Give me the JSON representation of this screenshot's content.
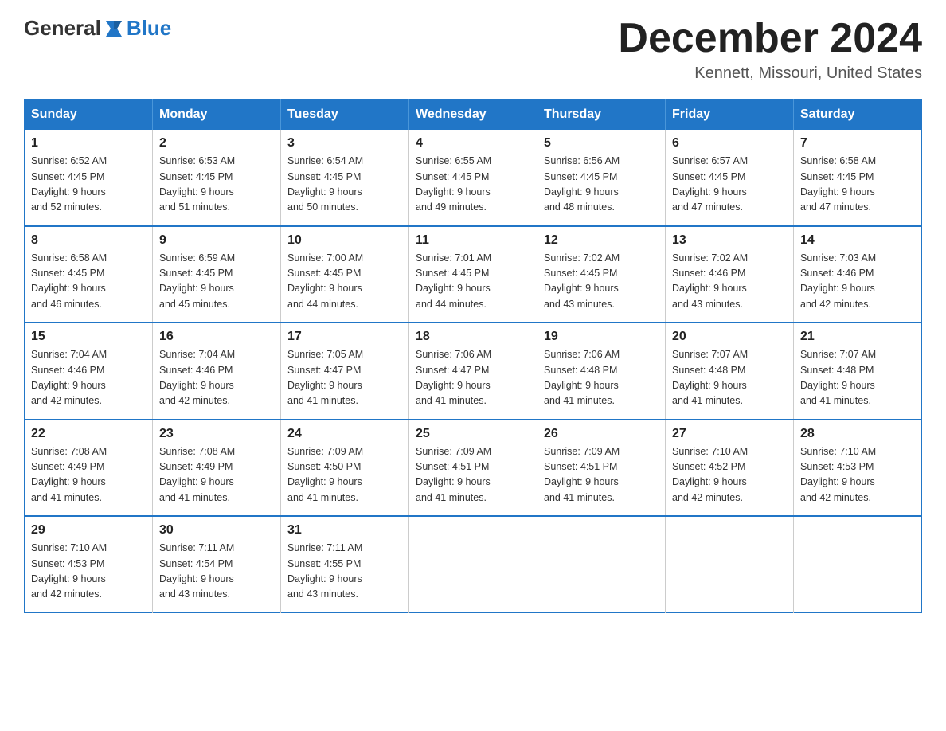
{
  "header": {
    "logo_general": "General",
    "logo_blue": "Blue",
    "month_title": "December 2024",
    "location": "Kennett, Missouri, United States"
  },
  "weekdays": [
    "Sunday",
    "Monday",
    "Tuesday",
    "Wednesday",
    "Thursday",
    "Friday",
    "Saturday"
  ],
  "weeks": [
    [
      {
        "day": "1",
        "sunrise": "6:52 AM",
        "sunset": "4:45 PM",
        "daylight": "9 hours and 52 minutes."
      },
      {
        "day": "2",
        "sunrise": "6:53 AM",
        "sunset": "4:45 PM",
        "daylight": "9 hours and 51 minutes."
      },
      {
        "day": "3",
        "sunrise": "6:54 AM",
        "sunset": "4:45 PM",
        "daylight": "9 hours and 50 minutes."
      },
      {
        "day": "4",
        "sunrise": "6:55 AM",
        "sunset": "4:45 PM",
        "daylight": "9 hours and 49 minutes."
      },
      {
        "day": "5",
        "sunrise": "6:56 AM",
        "sunset": "4:45 PM",
        "daylight": "9 hours and 48 minutes."
      },
      {
        "day": "6",
        "sunrise": "6:57 AM",
        "sunset": "4:45 PM",
        "daylight": "9 hours and 47 minutes."
      },
      {
        "day": "7",
        "sunrise": "6:58 AM",
        "sunset": "4:45 PM",
        "daylight": "9 hours and 47 minutes."
      }
    ],
    [
      {
        "day": "8",
        "sunrise": "6:58 AM",
        "sunset": "4:45 PM",
        "daylight": "9 hours and 46 minutes."
      },
      {
        "day": "9",
        "sunrise": "6:59 AM",
        "sunset": "4:45 PM",
        "daylight": "9 hours and 45 minutes."
      },
      {
        "day": "10",
        "sunrise": "7:00 AM",
        "sunset": "4:45 PM",
        "daylight": "9 hours and 44 minutes."
      },
      {
        "day": "11",
        "sunrise": "7:01 AM",
        "sunset": "4:45 PM",
        "daylight": "9 hours and 44 minutes."
      },
      {
        "day": "12",
        "sunrise": "7:02 AM",
        "sunset": "4:45 PM",
        "daylight": "9 hours and 43 minutes."
      },
      {
        "day": "13",
        "sunrise": "7:02 AM",
        "sunset": "4:46 PM",
        "daylight": "9 hours and 43 minutes."
      },
      {
        "day": "14",
        "sunrise": "7:03 AM",
        "sunset": "4:46 PM",
        "daylight": "9 hours and 42 minutes."
      }
    ],
    [
      {
        "day": "15",
        "sunrise": "7:04 AM",
        "sunset": "4:46 PM",
        "daylight": "9 hours and 42 minutes."
      },
      {
        "day": "16",
        "sunrise": "7:04 AM",
        "sunset": "4:46 PM",
        "daylight": "9 hours and 42 minutes."
      },
      {
        "day": "17",
        "sunrise": "7:05 AM",
        "sunset": "4:47 PM",
        "daylight": "9 hours and 41 minutes."
      },
      {
        "day": "18",
        "sunrise": "7:06 AM",
        "sunset": "4:47 PM",
        "daylight": "9 hours and 41 minutes."
      },
      {
        "day": "19",
        "sunrise": "7:06 AM",
        "sunset": "4:48 PM",
        "daylight": "9 hours and 41 minutes."
      },
      {
        "day": "20",
        "sunrise": "7:07 AM",
        "sunset": "4:48 PM",
        "daylight": "9 hours and 41 minutes."
      },
      {
        "day": "21",
        "sunrise": "7:07 AM",
        "sunset": "4:48 PM",
        "daylight": "9 hours and 41 minutes."
      }
    ],
    [
      {
        "day": "22",
        "sunrise": "7:08 AM",
        "sunset": "4:49 PM",
        "daylight": "9 hours and 41 minutes."
      },
      {
        "day": "23",
        "sunrise": "7:08 AM",
        "sunset": "4:49 PM",
        "daylight": "9 hours and 41 minutes."
      },
      {
        "day": "24",
        "sunrise": "7:09 AM",
        "sunset": "4:50 PM",
        "daylight": "9 hours and 41 minutes."
      },
      {
        "day": "25",
        "sunrise": "7:09 AM",
        "sunset": "4:51 PM",
        "daylight": "9 hours and 41 minutes."
      },
      {
        "day": "26",
        "sunrise": "7:09 AM",
        "sunset": "4:51 PM",
        "daylight": "9 hours and 41 minutes."
      },
      {
        "day": "27",
        "sunrise": "7:10 AM",
        "sunset": "4:52 PM",
        "daylight": "9 hours and 42 minutes."
      },
      {
        "day": "28",
        "sunrise": "7:10 AM",
        "sunset": "4:53 PM",
        "daylight": "9 hours and 42 minutes."
      }
    ],
    [
      {
        "day": "29",
        "sunrise": "7:10 AM",
        "sunset": "4:53 PM",
        "daylight": "9 hours and 42 minutes."
      },
      {
        "day": "30",
        "sunrise": "7:11 AM",
        "sunset": "4:54 PM",
        "daylight": "9 hours and 43 minutes."
      },
      {
        "day": "31",
        "sunrise": "7:11 AM",
        "sunset": "4:55 PM",
        "daylight": "9 hours and 43 minutes."
      },
      null,
      null,
      null,
      null
    ]
  ]
}
